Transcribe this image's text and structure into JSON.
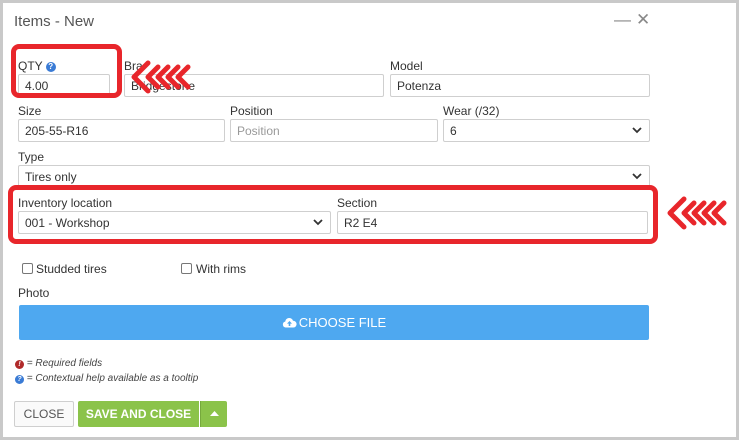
{
  "dialog": {
    "title": "Items - New"
  },
  "fields": {
    "qty": {
      "label": "QTY",
      "value": "4.00"
    },
    "brand": {
      "label": "Bra",
      "value": "Bridgestone"
    },
    "model": {
      "label": "Model",
      "value": "Potenza"
    },
    "size": {
      "label": "Size",
      "value": "205-55-R16"
    },
    "position": {
      "label": "Position",
      "placeholder": "Position"
    },
    "wear": {
      "label": "Wear (/32)",
      "value": "6"
    },
    "type": {
      "label": "Type",
      "value": "Tires only"
    },
    "inventory_location": {
      "label": "Inventory location",
      "value": "001 - Workshop"
    },
    "section": {
      "label": "Section",
      "value": "R2 E4"
    }
  },
  "checkboxes": {
    "studded": {
      "label": "Studded tires",
      "checked": false
    },
    "rims": {
      "label": "With rims",
      "checked": false
    }
  },
  "photo": {
    "label": "Photo",
    "button_label": "CHOOSE FILE"
  },
  "legend": {
    "required": "= Required fields",
    "help": "= Contextual help available as a tooltip"
  },
  "buttons": {
    "close": "CLOSE",
    "save_and_close": "SAVE AND CLOSE"
  },
  "colors": {
    "highlight": "#e8262b",
    "primary_blue": "#4ea8f0",
    "save_green": "#8bc34a",
    "help_blue": "#3a7bd5",
    "required_red": "#b02a2a"
  },
  "icons": {
    "help": "question-circle-icon",
    "required": "exclamation-circle-icon",
    "upload": "cloud-upload-icon",
    "dropdown": "chevron-down-icon",
    "caret": "caret-up-icon"
  }
}
